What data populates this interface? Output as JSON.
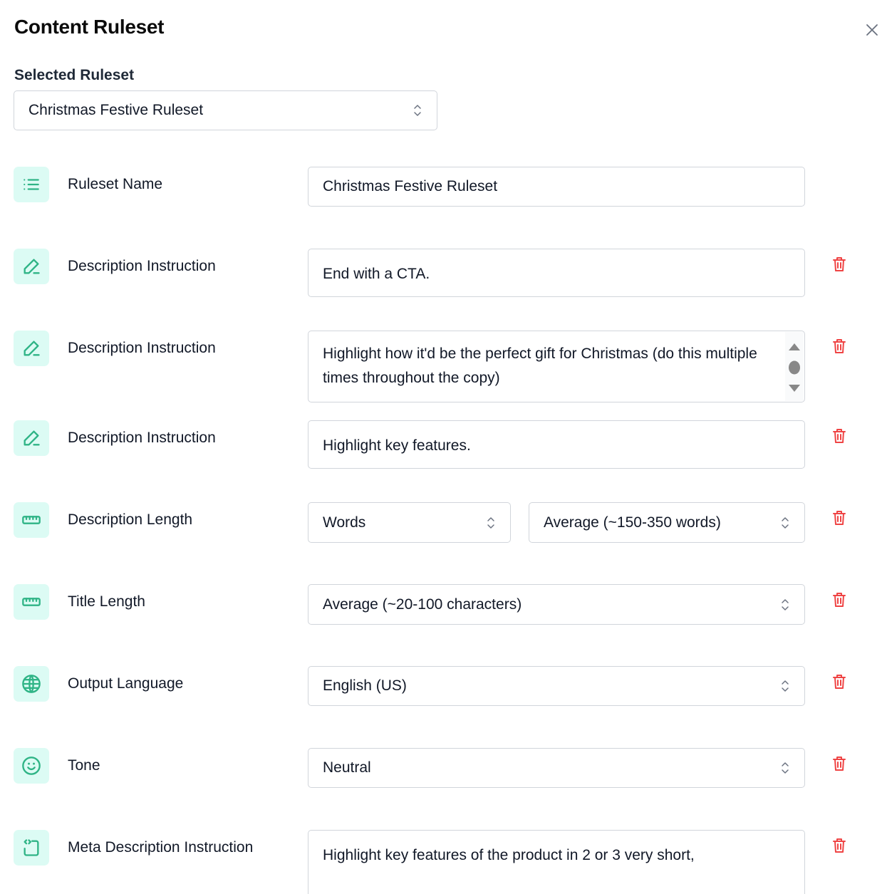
{
  "header": {
    "title": "Content Ruleset",
    "close_icon": "close-icon"
  },
  "selected_ruleset": {
    "label": "Selected Ruleset",
    "value": "Christmas Festive Ruleset"
  },
  "rules": [
    {
      "icon": "list-icon",
      "label": "Ruleset Name",
      "type": "text",
      "value": "Christmas Festive Ruleset",
      "deletable": false
    },
    {
      "icon": "pencil-icon",
      "label": "Description Instruction",
      "type": "textarea",
      "value": "End with a CTA.",
      "deletable": true
    },
    {
      "icon": "pencil-icon",
      "label": "Description Instruction",
      "type": "textarea",
      "value": "Highlight how it'd be the perfect gift for Christmas (do this multiple times throughout the copy)",
      "deletable": true
    },
    {
      "icon": "pencil-icon",
      "label": "Description Instruction",
      "type": "textarea",
      "value": "Highlight key features.",
      "deletable": true
    },
    {
      "icon": "ruler-icon",
      "label": "Description Length",
      "type": "double-select",
      "unit_value": "Words",
      "value": "Average (~150-350 words)",
      "deletable": true
    },
    {
      "icon": "ruler-icon",
      "label": "Title Length",
      "type": "select",
      "value": "Average (~20-100 characters)",
      "deletable": true
    },
    {
      "icon": "globe-icon",
      "label": "Output Language",
      "type": "select",
      "value": "English (US)",
      "deletable": true
    },
    {
      "icon": "smiley-icon",
      "label": "Tone",
      "type": "select",
      "value": "Neutral",
      "deletable": true
    },
    {
      "icon": "code-box-icon",
      "label": "Meta Description Instruction",
      "type": "textarea",
      "value": "Highlight key features of the product in 2 or 3 very short,",
      "deletable": true
    }
  ],
  "colors": {
    "accent": "#2fb486",
    "icon_bg": "#dcfbf4",
    "danger": "#ef4444",
    "border": "#d1d5db"
  }
}
